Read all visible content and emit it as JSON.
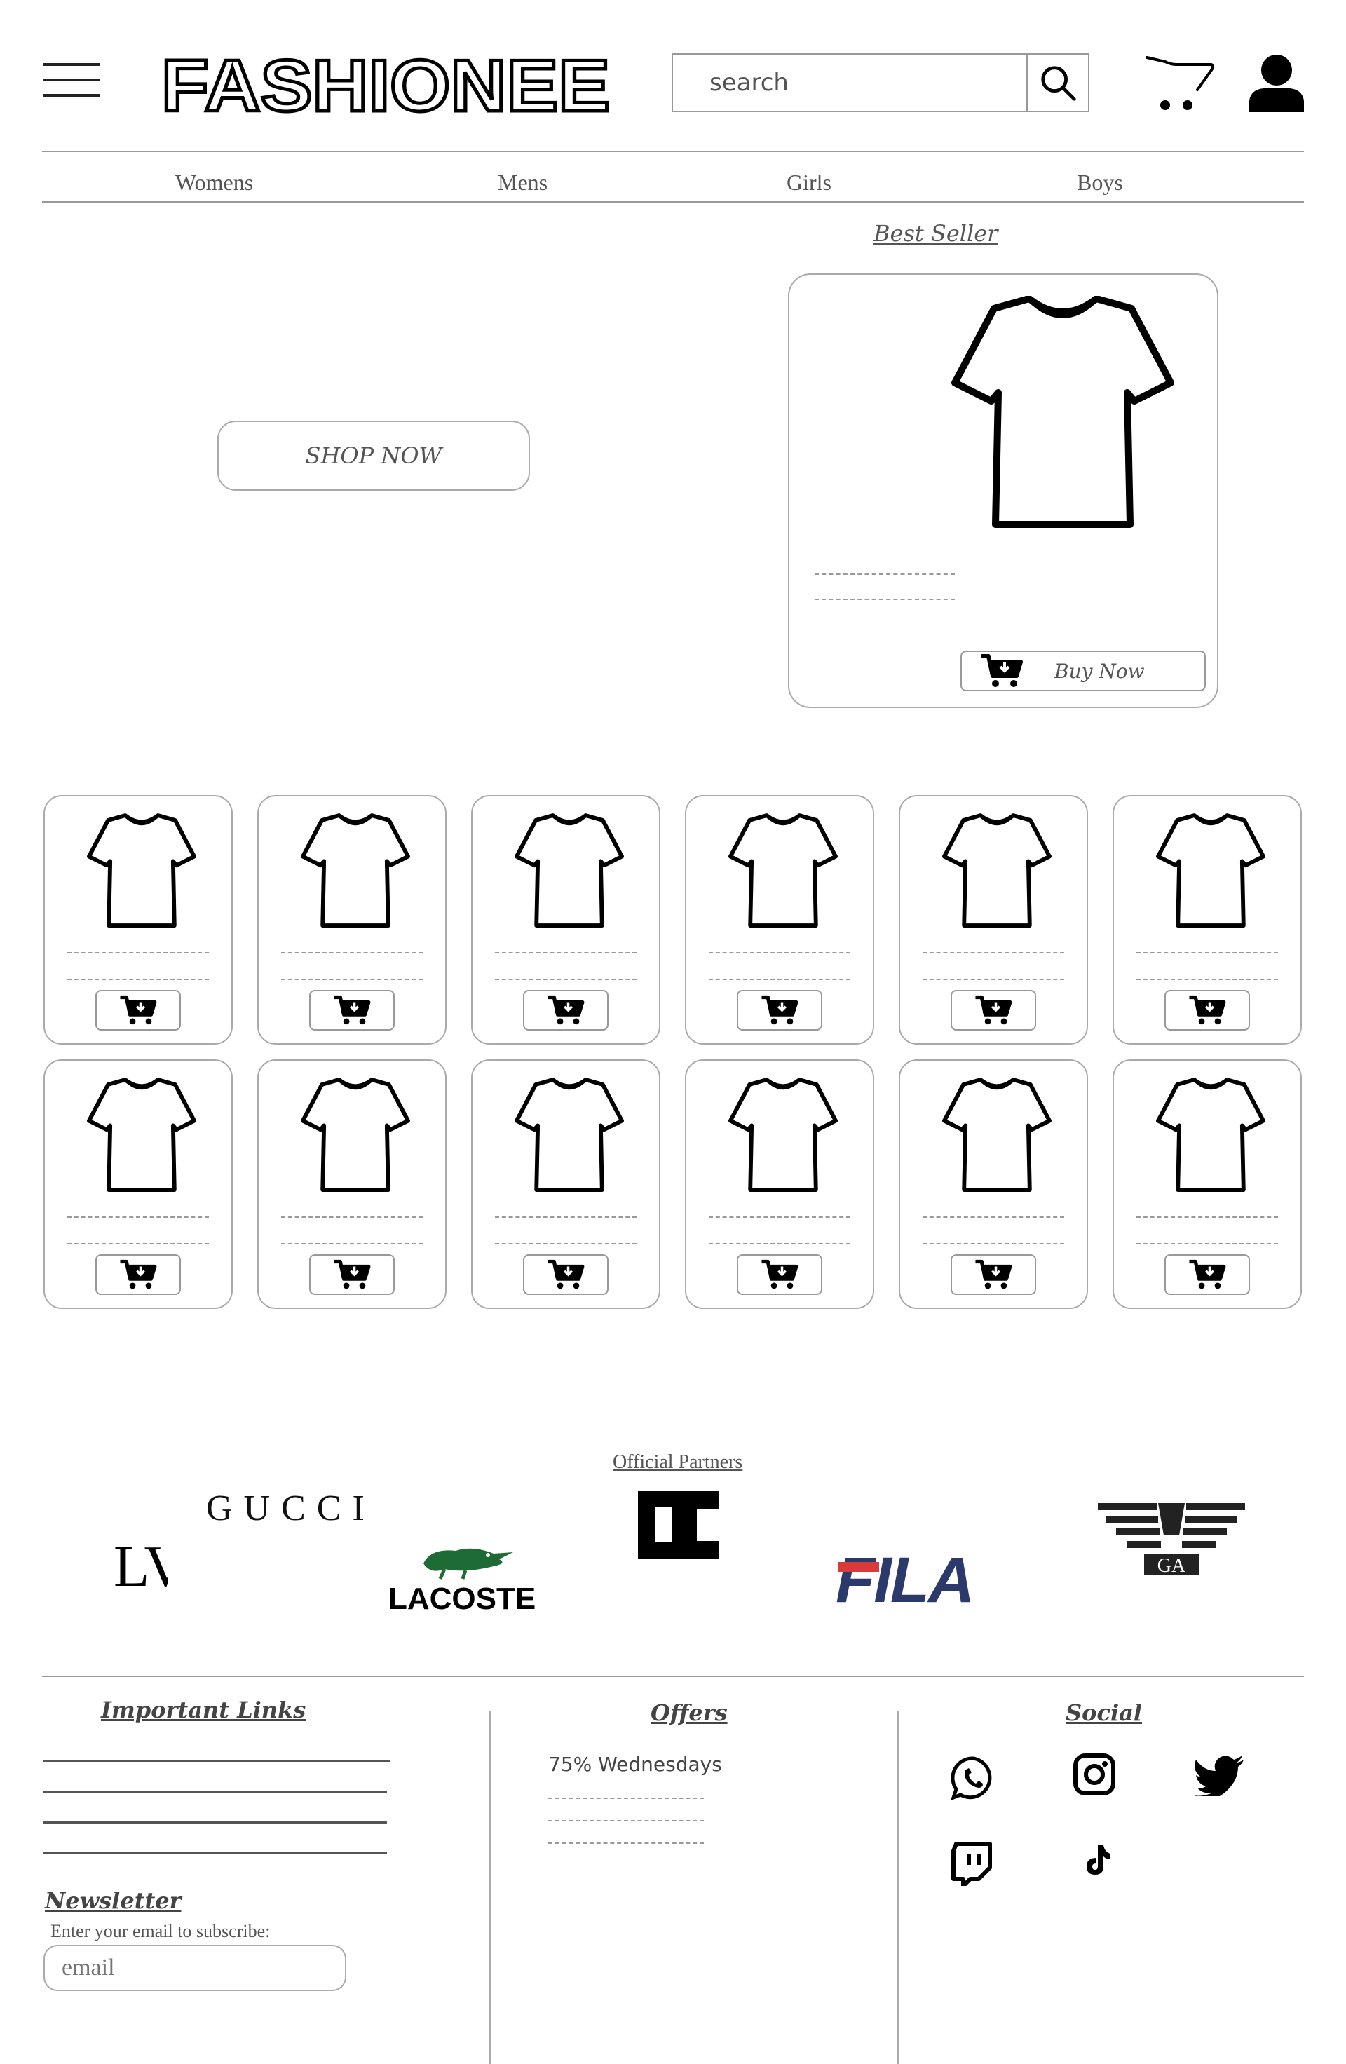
{
  "header": {
    "logo_text": "FASHIONEE",
    "search_placeholder": "search"
  },
  "nav": [
    "Womens",
    "Mens",
    "Girls",
    "Boys"
  ],
  "hero": {
    "shop_now_label": "SHOP NOW",
    "best_seller_label": "Best Seller",
    "buy_now_label": "Buy Now"
  },
  "partners": {
    "title": "Official Partners",
    "brands": [
      "LV",
      "GUCCI",
      "LACOSTE",
      "DC",
      "FILA",
      "GA"
    ]
  },
  "footer": {
    "important_links_title": "Important Links",
    "newsletter_title": "Newsletter",
    "newsletter_prompt": "Enter your email to subscribe:",
    "email_placeholder": "email",
    "offers_title": "Offers",
    "offer_item": "75% Wednesdays",
    "social_title": "Social",
    "social_icons": [
      "whatsapp-icon",
      "instagram-icon",
      "twitter-icon",
      "twitch-icon",
      "tiktok-icon"
    ]
  },
  "colors": {
    "fila_red": "#d93a3a",
    "fila_navy": "#2b3a6b",
    "lacoste_green": "#1f6b35"
  }
}
